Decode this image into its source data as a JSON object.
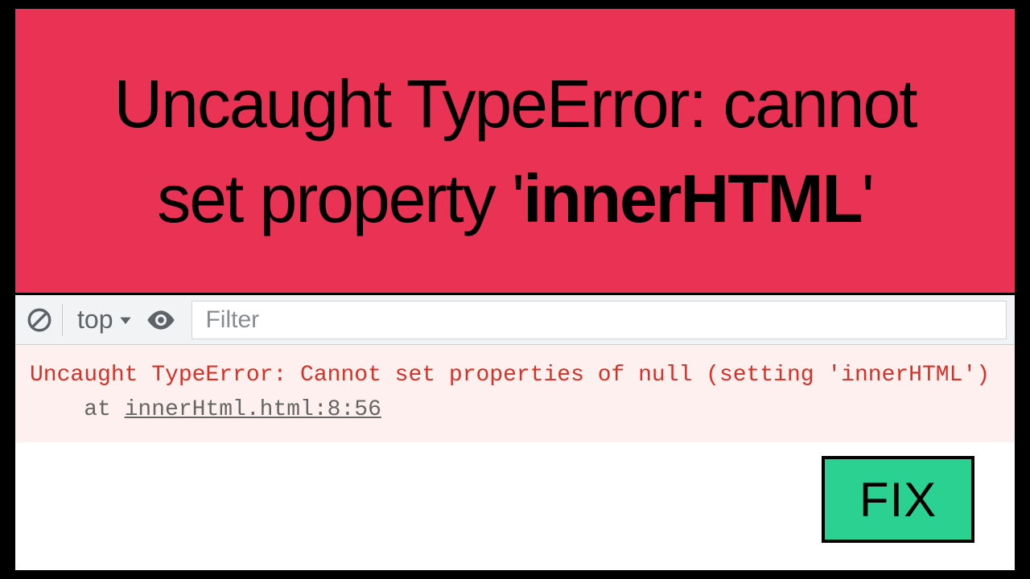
{
  "hero": {
    "line1": "Uncaught TypeError: cannot",
    "line2_pre": "set property '",
    "line2_bold": "innerHTML",
    "line2_post": "'"
  },
  "toolbar": {
    "clear_icon": "clear-icon",
    "context_label": "top",
    "eye_icon": "eye-icon",
    "filter_placeholder": "Filter"
  },
  "console": {
    "error_line": "Uncaught TypeError: Cannot set properties of null (setting 'innerHTML')",
    "at_prefix": "    at ",
    "source": "innerHtml.html:8:56"
  },
  "fix_button": {
    "label": "FIX"
  }
}
